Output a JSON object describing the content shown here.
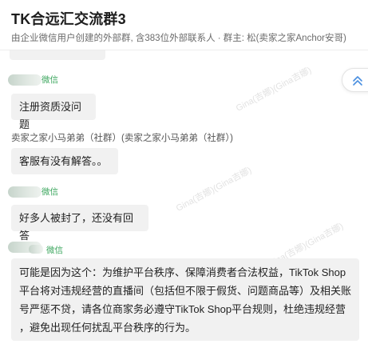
{
  "header": {
    "title": "TK合远汇交流群3",
    "subtitle": "由企业微信用户创建的外部群, 含383位外部联系人 · 群主: 松(卖家之家Anchor安哥)"
  },
  "watermark": "Gina(吉娜)(Gina吉娜)",
  "messages": [
    {
      "sender_tag": "微信",
      "text": "注册资质没问题"
    },
    {
      "sender_name": "卖家之家小马弟弟（社群）(卖家之家小马弟弟（社群）)",
      "text": "客服有没有解答。。"
    },
    {
      "sender_tag": "微信",
      "text": "好多人被封了，还没有回答"
    },
    {
      "sender_tag": "微信",
      "lines": [
        "可能是因为这个：为维护平台秩序、保障消费者合法权益，TikTok Shop",
        "平台将对违规经营的直播间（包括但不限于假货、问题商品等）及相关账",
        "号严惩不贷，请各位商家务必遵守TikTok Shop平台规则，杜绝违规经营",
        "，避免出现任何扰乱平台秩序的行为。"
      ]
    }
  ],
  "icons": {
    "scroll_top": "double-chevron-up-icon"
  },
  "colors": {
    "accent": "#3aa55c",
    "bubble": "#f1f1f1",
    "scroll_arrow": "#4a8fe0"
  }
}
